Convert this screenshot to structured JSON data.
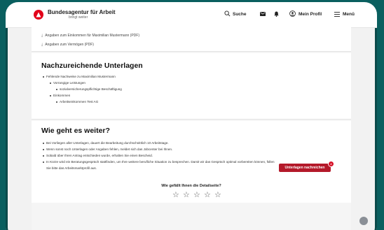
{
  "header": {
    "brand_name": "Bundesagentur für Arbeit",
    "brand_sub": "bringt weiter",
    "search_label": "Suche",
    "profile_label": "Mein Profil",
    "menu_label": "Menü"
  },
  "downloads": {
    "items": [
      "Angaben zum Einkommen für Maximilian Mustermann (PDF)",
      "Angaben zum Vermögen (PDF)"
    ]
  },
  "insufficient": {
    "title": "Nachzureichende Unterlagen",
    "missing_label": "Fehlende Nachweise zu Maximilian Mustermann",
    "group1": "Vorrangige Leistungen",
    "group1_item": "sozialversicherungspflichtige Beschäftigung",
    "group2": "Einkommen",
    "group2_item": "Arbeitseinkommen Test AG"
  },
  "next_steps": {
    "title": "Wie geht es weiter?",
    "items": [
      "Bei Vorliegen aller Unterlagen, dauert die Bearbeitung durchschnittlich 10 Arbeitstage.",
      "Wenn sonst noch Unterlagen oder Angaben fehlen, meldet sich das Jobcenter bei Ihnen.",
      "Sobald über Ihren Antrag entschieden wurde, erhalten Sie einen Bescheid.",
      "In Kürze wird ein Beratungsgespräch stattfinden, um Ihre weitere berufliche Situation zu besprechen. Damit wir das Gespräch optimal vorbereiten können, füllen",
      "Sie bitte das Arbeitsmarktprofil aus."
    ]
  },
  "cta": {
    "label": "Unterlagen nachreichen",
    "badge": "2"
  },
  "feedback": {
    "question": "Wie gefällt Ihnen die Detailseite?",
    "stars": 5
  },
  "colors": {
    "accent": "#b4192a",
    "brand": "#e2001a",
    "frame": "#0a5f5f"
  }
}
